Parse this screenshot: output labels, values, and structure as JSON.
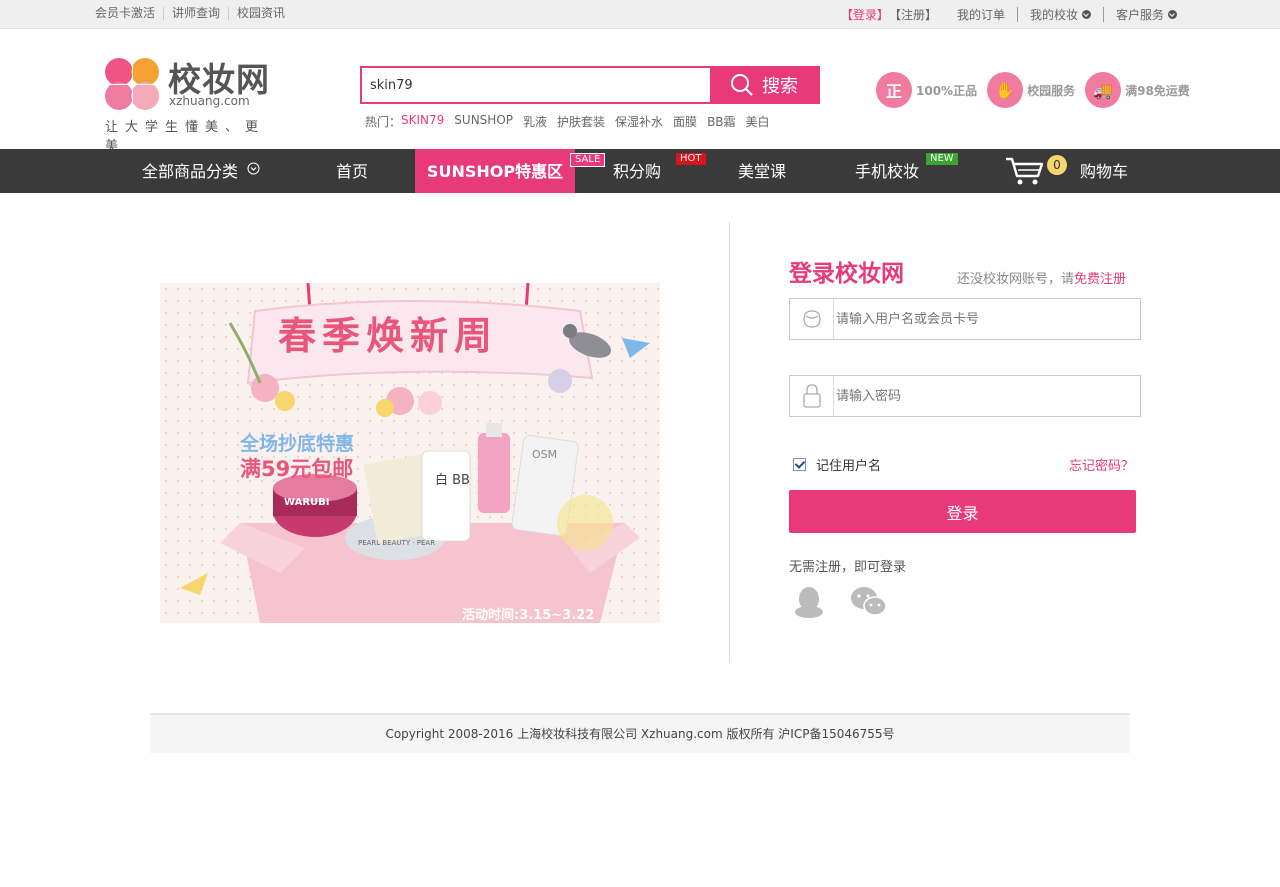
{
  "topbar": {
    "left_links": [
      "会员卡激活",
      "讲师查询",
      "校园资讯"
    ],
    "login": "【登录】",
    "register": "【注册】",
    "orders": "我的订单",
    "my_school": "我的校妆",
    "service": "客户服务"
  },
  "logo": {
    "name": "校妆网",
    "domain": "xzhuang.com",
    "slogan": "让大学生懂美、更美"
  },
  "search": {
    "value": "skin79",
    "button": "搜索"
  },
  "hot": {
    "label": "热门：",
    "terms": [
      "SKIN79",
      "SUNSHOP",
      "乳液",
      "护肤套装",
      "保湿补水",
      "面膜",
      "BB霜",
      "美白"
    ]
  },
  "badges": [
    {
      "icon": "正",
      "label": "100%正品"
    },
    {
      "icon": "✋",
      "label": "校园服务"
    },
    {
      "icon": "🚚",
      "label": "满98免运费"
    }
  ],
  "nav": {
    "all": "全部商品分类",
    "home": "首页",
    "sunshop": "SUNSHOP特惠区",
    "sunshop_tag": "SALE",
    "points": "积分购",
    "points_tag": "HOT",
    "class": "美堂课",
    "mobile": "手机校妆",
    "mobile_tag": "NEW",
    "cart_count": "0",
    "cart": "购物车"
  },
  "banner": {
    "title": "春季焕新周",
    "line1": "全场抄底特惠",
    "line2": "满59元包邮",
    "period": "活动时间:3.15~3.22",
    "products": [
      "WARUBI",
      "PEARL BEAUTY · PEAR",
      "白 BB",
      "OSM"
    ]
  },
  "login": {
    "title": "登录校妆网",
    "no_account": "还没校妆网账号，请",
    "free_register": "免费注册",
    "username_placeholder": "请输入用户名或会员卡号",
    "password_placeholder": "请输入密码",
    "remember": "记住用户名",
    "forgot": "忘记密码？",
    "submit": "登录",
    "no_register": "无需注册，即可登录"
  },
  "footer": {
    "copyright": "Copyright 2008-2016 上海校妆科技有限公司 Xzhuang.com 版权所有 沪ICP备15046755号"
  },
  "colors": {
    "brand": "#e83a78",
    "nav_bg": "#3a3a3a"
  }
}
